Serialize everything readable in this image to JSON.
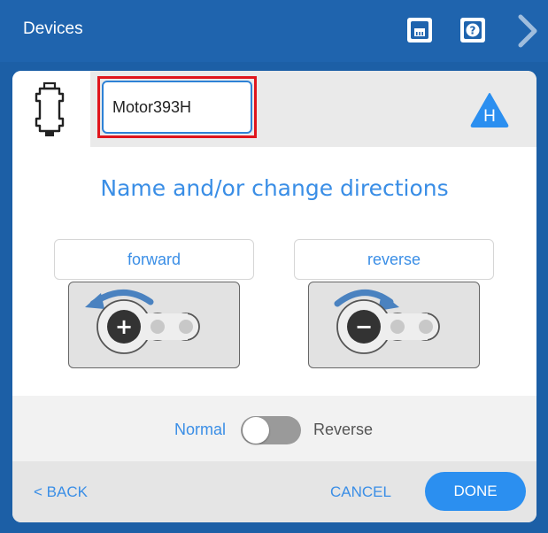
{
  "window": {
    "title": "Devices"
  },
  "toolbar": {
    "port_icon": "ethernet-port-icon",
    "help_icon": "question-mark-icon",
    "help_glyph": "?",
    "next_icon": "chevron-right-icon"
  },
  "device": {
    "icon": "motor-icon",
    "name_value": "Motor393H",
    "badge_icon": "warning-triangle-icon",
    "badge_letter": "H"
  },
  "main": {
    "heading": "Name and/or change directions",
    "forward_label": "forward",
    "reverse_label": "reverse",
    "forward_sign": "+",
    "reverse_sign": "−"
  },
  "toggle": {
    "left_label": "Normal",
    "right_label": "Reverse",
    "state": "Normal"
  },
  "footer": {
    "back_label": "< BACK",
    "cancel_label": "CANCEL",
    "done_label": "DONE"
  },
  "colors": {
    "titlebar": "#1f64ae",
    "accent": "#3a8ee6",
    "done_button": "#2b8ff0",
    "highlight": "#e0161d"
  }
}
